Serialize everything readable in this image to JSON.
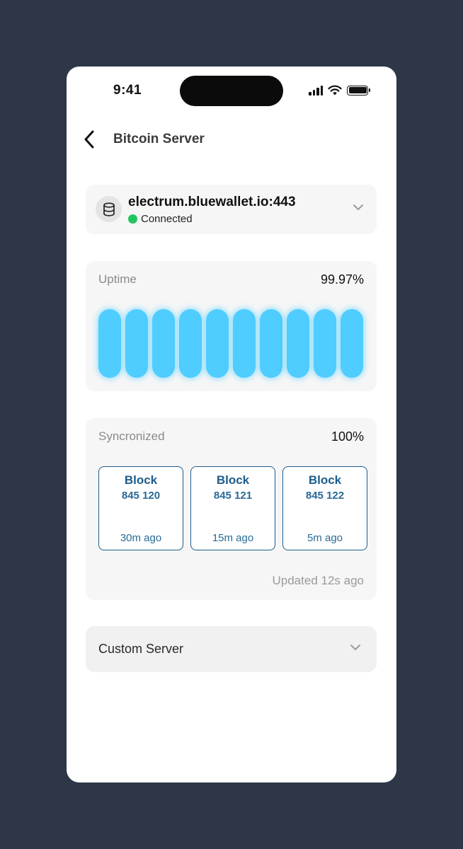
{
  "status_bar": {
    "time": "9:41"
  },
  "header": {
    "title": "Bitcoin Server"
  },
  "server": {
    "host": "electrum.bluewallet.io:443",
    "status": "Connected",
    "status_color": "#22c55e"
  },
  "uptime": {
    "label": "Uptime",
    "value": "99.97%",
    "bar_count": 10,
    "bar_color": "#4fcdff"
  },
  "sync": {
    "label": "Syncronized",
    "value": "100%",
    "blocks": [
      {
        "label": "Block",
        "number": "845 120",
        "ago": "30m ago"
      },
      {
        "label": "Block",
        "number": "845 121",
        "ago": "15m ago"
      },
      {
        "label": "Block",
        "number": "845 122",
        "ago": "5m ago"
      }
    ],
    "updated": "Updated 12s ago"
  },
  "custom_server": {
    "label": "Custom Server"
  },
  "icons": {
    "back": "chevron-left-icon",
    "server": "database-icon",
    "expand": "chevron-down-icon"
  }
}
